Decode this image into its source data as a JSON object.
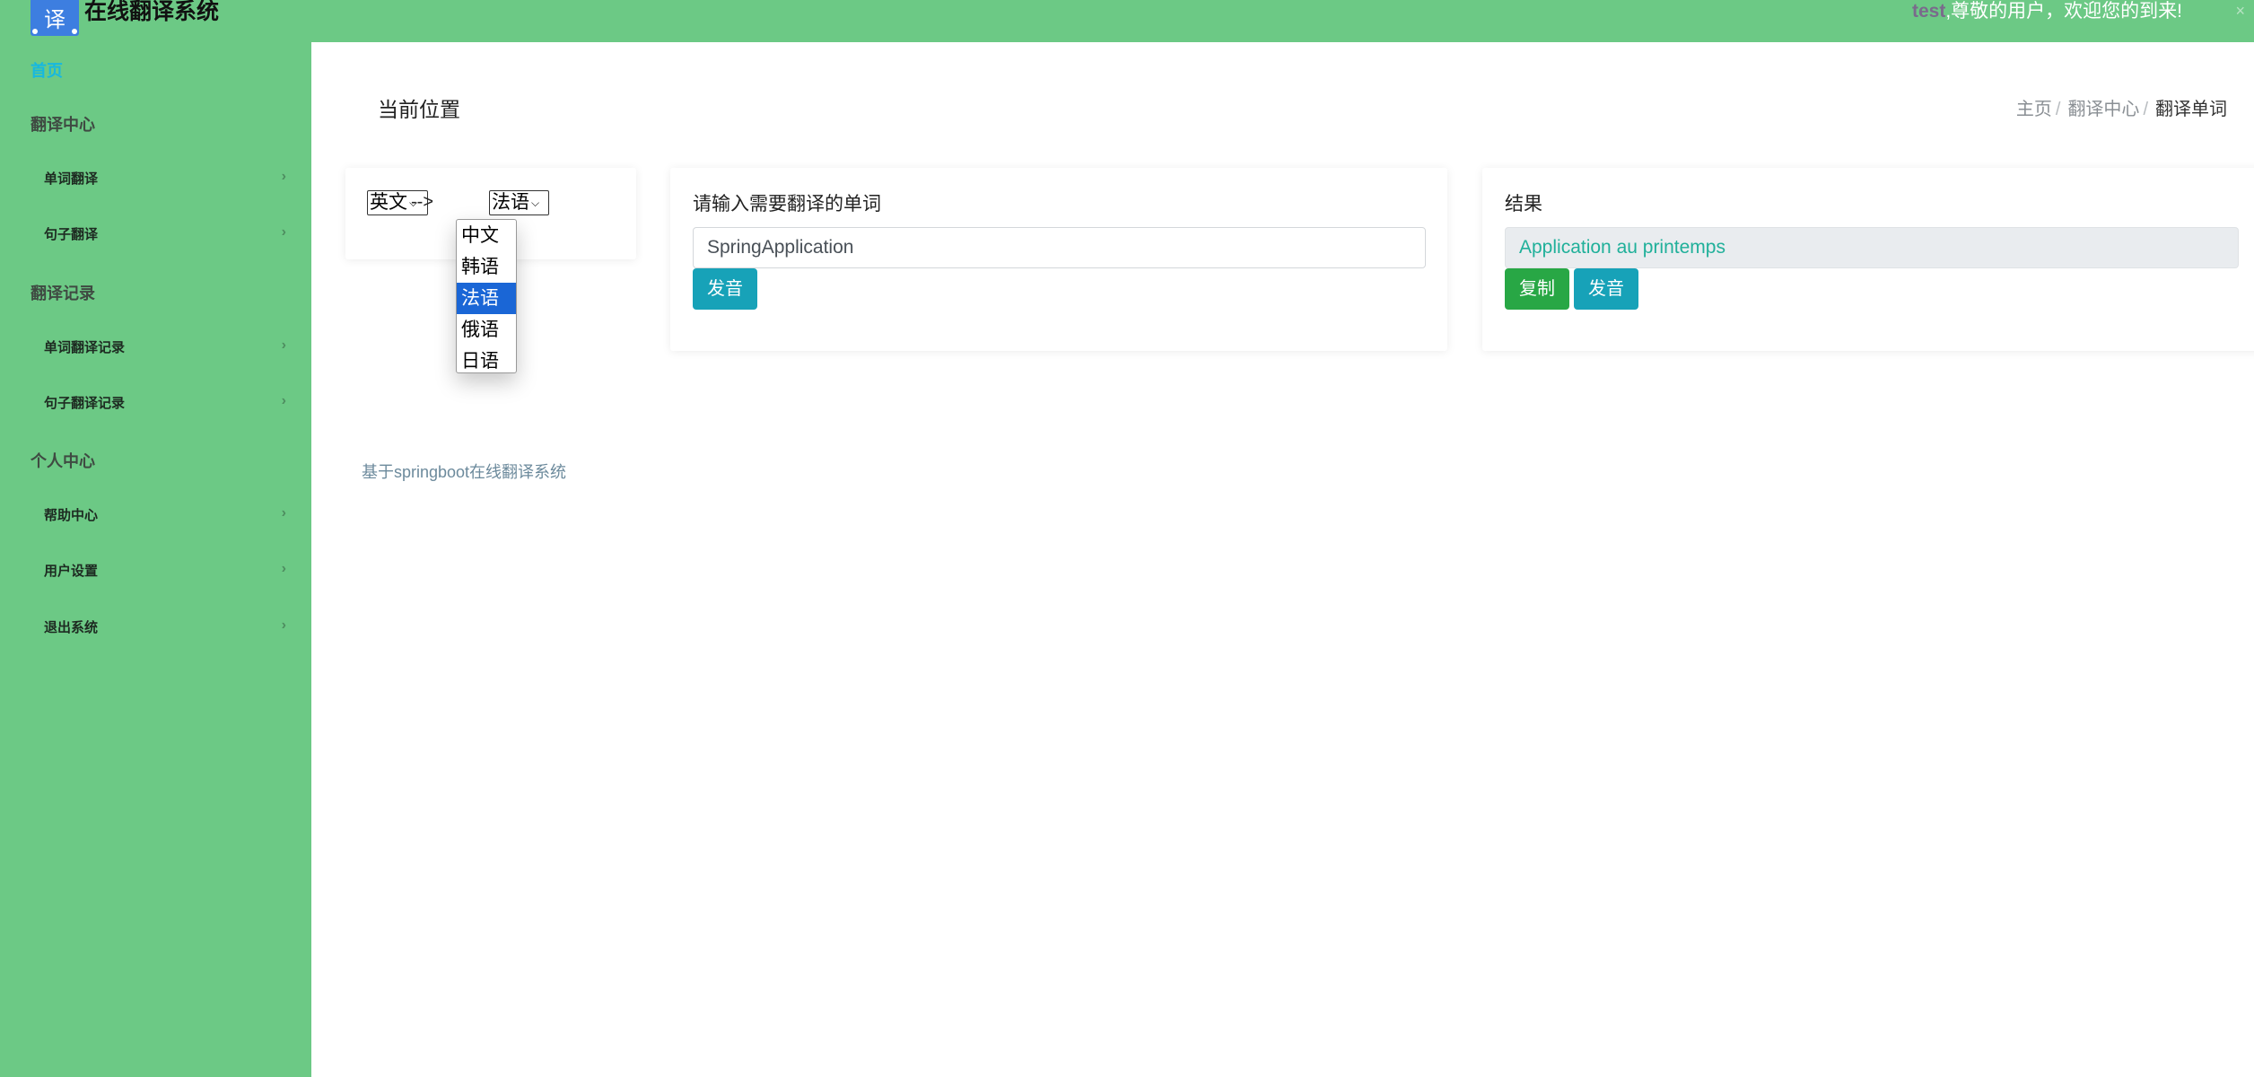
{
  "header": {
    "logo_glyph": "译",
    "app_title": "在线翻译系统",
    "username": "test",
    "welcome_text": ",尊敬的用户，欢迎您的到来!",
    "close_glyph": "×"
  },
  "sidebar": {
    "home": "首页",
    "groups": [
      {
        "label": "翻译中心",
        "items": [
          "单词翻译",
          "句子翻译"
        ]
      },
      {
        "label": "翻译记录",
        "items": [
          "单词翻译记录",
          "句子翻译记录"
        ]
      },
      {
        "label": "个人中心",
        "items": [
          "帮助中心",
          "用户设置",
          "退出系统"
        ]
      }
    ],
    "chevron": "›"
  },
  "main": {
    "location_title": "当前位置",
    "breadcrumb": [
      "主页",
      "翻译中心",
      "翻译单词"
    ],
    "breadcrumb_sep": "/",
    "source_lang": "英文",
    "arrow": "-->",
    "target_lang": "法语",
    "lang_options": [
      "中文",
      "韩语",
      "法语",
      "俄语",
      "日语"
    ],
    "selected_option_index": 2,
    "input_label": "请输入需要翻译的单词",
    "input_value": "SpringApplication",
    "speak_button": "发音",
    "result_label": "结果",
    "result_value": "Application au printemps",
    "copy_button": "复制",
    "result_speak_button": "发音",
    "footer": "基于springboot在线翻译系统"
  },
  "colors": {
    "sidebar_bg": "#6cc985",
    "home_link": "#16b8e0",
    "button_info": "#17a2b8",
    "button_success": "#28a745",
    "option_selected": "#1a66d6"
  }
}
